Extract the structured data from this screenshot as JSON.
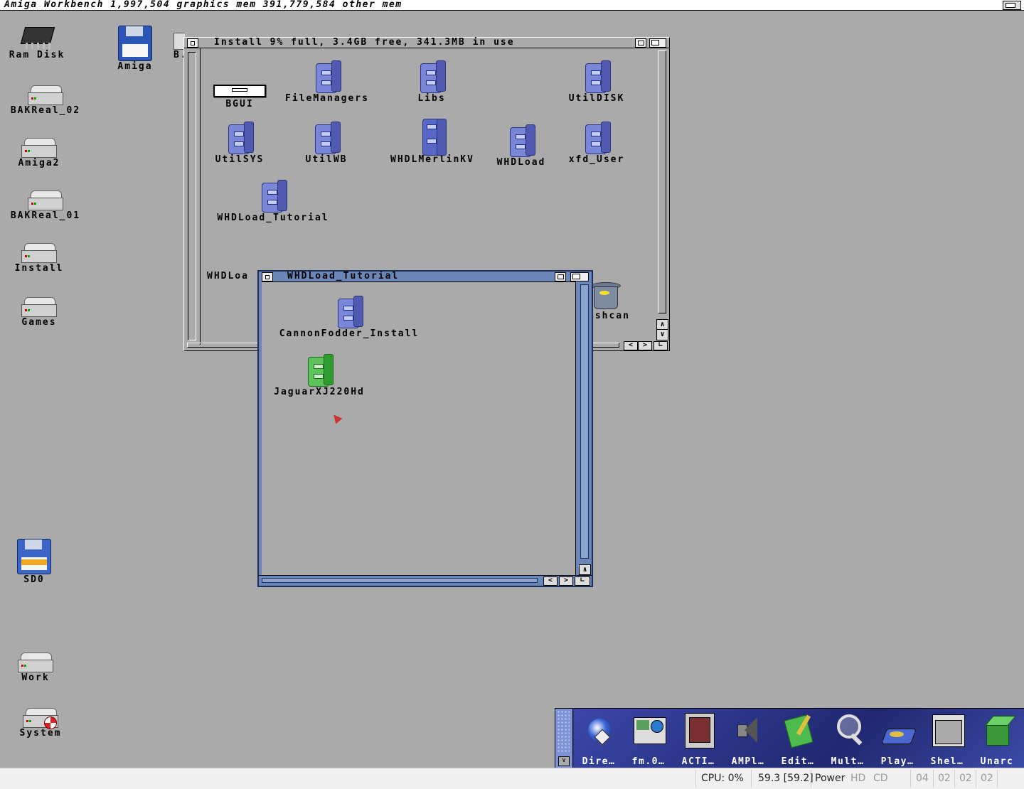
{
  "screen": {
    "title": "Amiga Workbench  1,997,504 graphics mem  391,779,584 other mem"
  },
  "desktop_icons": [
    {
      "label": "Ram Disk",
      "icon": "ram-chip-icon"
    },
    {
      "label": "Amiga",
      "icon": "floppy-disk-icon"
    },
    {
      "label": "B.",
      "icon": "drive-icon"
    },
    {
      "label": "BAKReal_02",
      "icon": "hard-drive-icon"
    },
    {
      "label": "Amiga2",
      "icon": "hard-drive-icon"
    },
    {
      "label": "BAKReal_01",
      "icon": "hard-drive-icon"
    },
    {
      "label": "Install",
      "icon": "hard-drive-icon"
    },
    {
      "label": "Games",
      "icon": "hard-drive-icon"
    },
    {
      "label": "SD0",
      "icon": "floppy-disk-icon"
    },
    {
      "label": "Work",
      "icon": "hard-drive-icon"
    },
    {
      "label": "System",
      "icon": "system-drive-icon"
    }
  ],
  "install_window": {
    "title": "Install  9% full, 3.4GB free, 341.3MB  in  use",
    "icons": [
      {
        "label": "BGUI",
        "icon": "drawer-icon"
      },
      {
        "label": "FileManagers",
        "icon": "cabinet-icon"
      },
      {
        "label": "Libs",
        "icon": "cabinet-icon"
      },
      {
        "label": "UtilDISK",
        "icon": "cabinet-icon"
      },
      {
        "label": "UtilSYS",
        "icon": "cabinet-icon"
      },
      {
        "label": "UtilWB",
        "icon": "cabinet-icon"
      },
      {
        "label": "WHDLMerlinKV",
        "icon": "tall-cabinet-icon"
      },
      {
        "label": "WHDLoad",
        "icon": "cabinet-icon"
      },
      {
        "label": "xfd_User",
        "icon": "cabinet-icon"
      },
      {
        "label": "WHDLoad_Tutorial",
        "icon": "cabinet-icon"
      },
      {
        "label": "WHDLoa",
        "icon": "cabinet-icon"
      },
      {
        "label": "ashcan",
        "icon": "trashcan-icon"
      }
    ]
  },
  "tutorial_window": {
    "title": "WHDLoad_Tutorial",
    "icons": [
      {
        "label": "CannonFodder_Install",
        "icon": "cabinet-icon"
      },
      {
        "label": "JaguarXJ220Hd",
        "icon": "green-cabinet-icon"
      }
    ]
  },
  "dock": {
    "items": [
      {
        "label": "Dire…",
        "icon": "directory-opus-icon"
      },
      {
        "label": "fm.0…",
        "icon": "file-manager-icon"
      },
      {
        "label": "ACTI…",
        "icon": "activity-icon"
      },
      {
        "label": "AMPl…",
        "icon": "speaker-icon"
      },
      {
        "label": "Edit…",
        "icon": "notepad-icon"
      },
      {
        "label": "Mult…",
        "icon": "magnifier-icon"
      },
      {
        "label": "Play…",
        "icon": "player-icon"
      },
      {
        "label": "Shel…",
        "icon": "shell-icon"
      },
      {
        "label": "Unarc",
        "icon": "unarc-cube-icon"
      }
    ]
  },
  "statusbar": {
    "cpu": "CPU: 0%",
    "fps": "59.3 [59.2]",
    "power": "Power",
    "hd": "HD",
    "cd": "CD",
    "df0": "04",
    "df1": "02",
    "df2": "02",
    "df3": "02"
  },
  "colors": {
    "desktop": "#aaaaaa",
    "active_window_frame": "#6b87b8",
    "cabinet_blue": "#7a86d8",
    "cabinet_green": "#5cc35a"
  }
}
